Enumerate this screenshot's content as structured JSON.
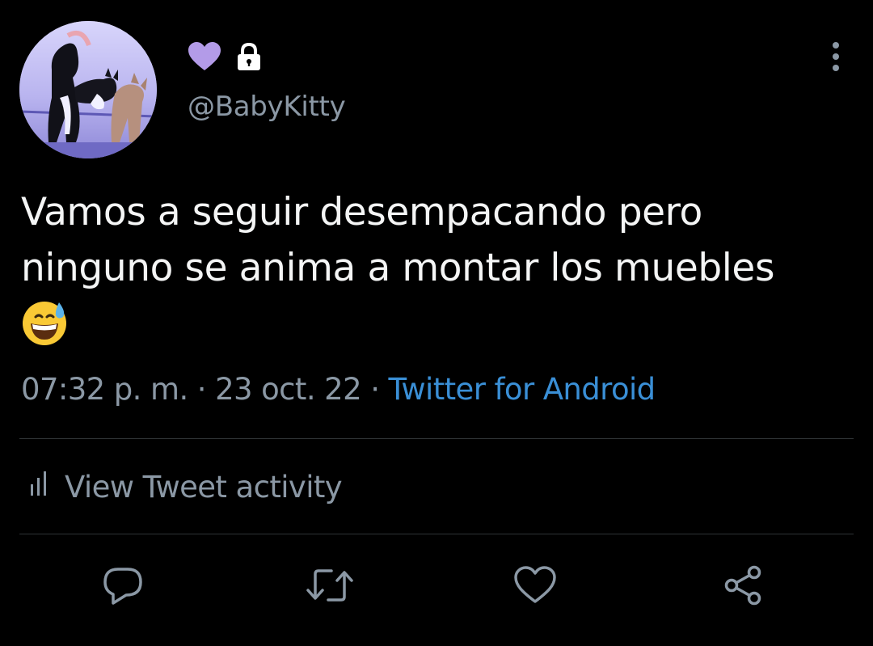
{
  "profile": {
    "handle": "@BabyKitty",
    "display_name_icons": [
      "purple-heart-icon",
      "lock-icon"
    ],
    "avatar_desc": "avatar"
  },
  "tweet": {
    "text": "Vamos a seguir desempacando pero ninguno se anima a montar los muebles",
    "emoji": "grinning-face-with-sweat-icon"
  },
  "meta": {
    "time": "07:32 p. m.",
    "sep1": " · ",
    "date": "23 oct. 22",
    "sep2": " · ",
    "source": "Twitter for Android"
  },
  "activity": {
    "label": "View Tweet activity"
  },
  "actions": [
    "reply-icon",
    "retweet-icon",
    "like-icon",
    "share-icon"
  ],
  "colors": {
    "background": "#000000",
    "text_primary": "#f4f5f5",
    "text_secondary": "#8b98a5",
    "link": "#3a8fd6",
    "heart": "#b39be8",
    "divider": "#2f3336"
  }
}
